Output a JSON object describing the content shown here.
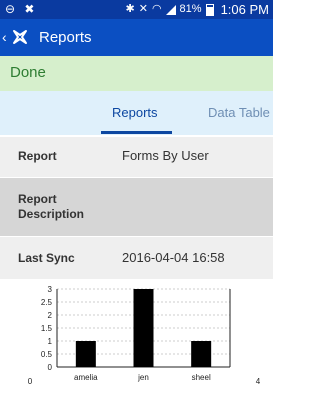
{
  "status_bar": {
    "battery": "81%",
    "time": "1:06 PM",
    "icons": [
      "minus-circle-icon",
      "app-logo-icon",
      "bluetooth-icon",
      "mute-icon",
      "wifi-icon",
      "signal-icon",
      "battery-icon"
    ]
  },
  "app_bar": {
    "title": "Reports",
    "icons": [
      "back-chevron-icon",
      "app-logo-icon"
    ]
  },
  "status_banner": {
    "text": "Done"
  },
  "tabs": [
    {
      "label": "Reports",
      "selected": true
    },
    {
      "label": "Data Table",
      "selected": false
    }
  ],
  "report_info": {
    "rows": [
      {
        "label": "Report",
        "value": "Forms By User"
      },
      {
        "label": "Report Description",
        "value": ""
      },
      {
        "label": "Last Sync",
        "value": "2016-04-04 16:58"
      }
    ]
  },
  "chart_data": {
    "type": "bar",
    "categories": [
      "amelia",
      "jen",
      "sheel"
    ],
    "values": [
      1,
      3,
      1
    ],
    "y_ticks": [
      "0",
      "0.5",
      "1",
      "1.5",
      "2",
      "2.5",
      "3"
    ],
    "ylim": [
      0,
      3
    ],
    "x_ticks": [
      "0",
      "4"
    ],
    "xlim": [
      0,
      4
    ],
    "grid": true,
    "bar_color": "#000000"
  },
  "colors": {
    "status_bar": "#0a3aa0",
    "app_bar": "#0b4fc2",
    "done_banner_bg": "#d6efcc",
    "done_text": "#2e7d32",
    "tab_bar_bg": "#dff0fb",
    "tab_active": "#0d47a1"
  }
}
